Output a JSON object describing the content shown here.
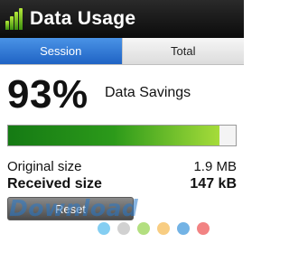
{
  "app": {
    "title": "Data Usage"
  },
  "tabs": [
    {
      "label": "Session",
      "active": true
    },
    {
      "label": "Total",
      "active": false
    }
  ],
  "savings": {
    "percent_text": "93%",
    "percent_value": 93,
    "label": "Data Savings"
  },
  "sizes": {
    "original_label": "Original size",
    "original_value": "1.9 MB",
    "received_label": "Received size",
    "received_value": "147 kB"
  },
  "buttons": {
    "reset": "Reset"
  },
  "watermark": {
    "text": "Download",
    "dot_colors": [
      "#6ec6f0",
      "#c9c9c9",
      "#a6d96a",
      "#f7c46c",
      "#5aa6e0",
      "#f06d6d"
    ]
  },
  "colors": {
    "active_tab": "#2f77d4",
    "progress_fill_start": "#157a14",
    "progress_fill_end": "#a6dc3a"
  }
}
